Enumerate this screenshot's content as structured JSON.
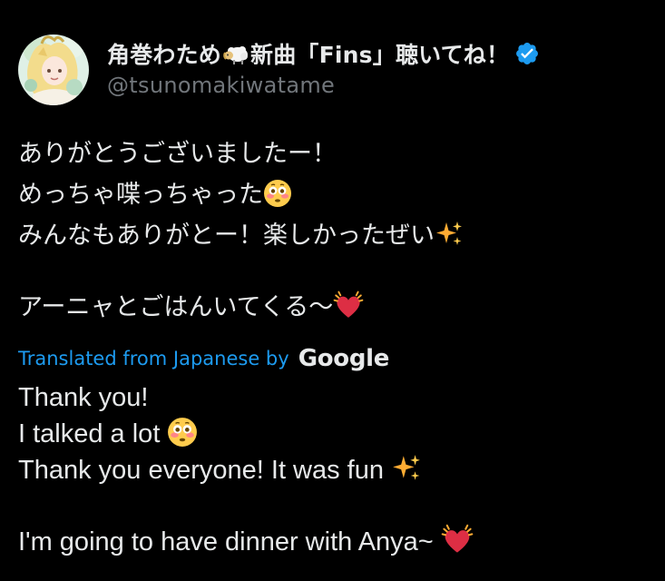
{
  "author": {
    "display_name_part1": "角巻わため",
    "display_name_part2": "新曲「Fins」聴いてね！",
    "handle": "@tsunomakiwatame",
    "avatar_icon": "avatar-image",
    "verified_icon": "verified-badge-icon",
    "verified_color": "#1d9bf0"
  },
  "tweet": {
    "lines": [
      "ありがとうございましたー！",
      "めっちゃ喋っちゃった",
      "みんなもありがとー！楽しかったぜい",
      "アーニャとごはんいてくる〜"
    ]
  },
  "translation": {
    "link_text": "Translated from Japanese by",
    "provider": "Google",
    "lines": [
      "Thank you!",
      "I talked a lot",
      "Thank you everyone! It was fun",
      "I'm going to have dinner with Anya~"
    ]
  },
  "colors": {
    "background": "#000000",
    "text": "#e7e9ea",
    "secondary": "#71767b",
    "accent": "#1d9bf0"
  },
  "icons": [
    "sheep-emoji-icon",
    "flushed-face-emoji-icon",
    "sparkles-emoji-icon",
    "beating-heart-emoji-icon"
  ]
}
